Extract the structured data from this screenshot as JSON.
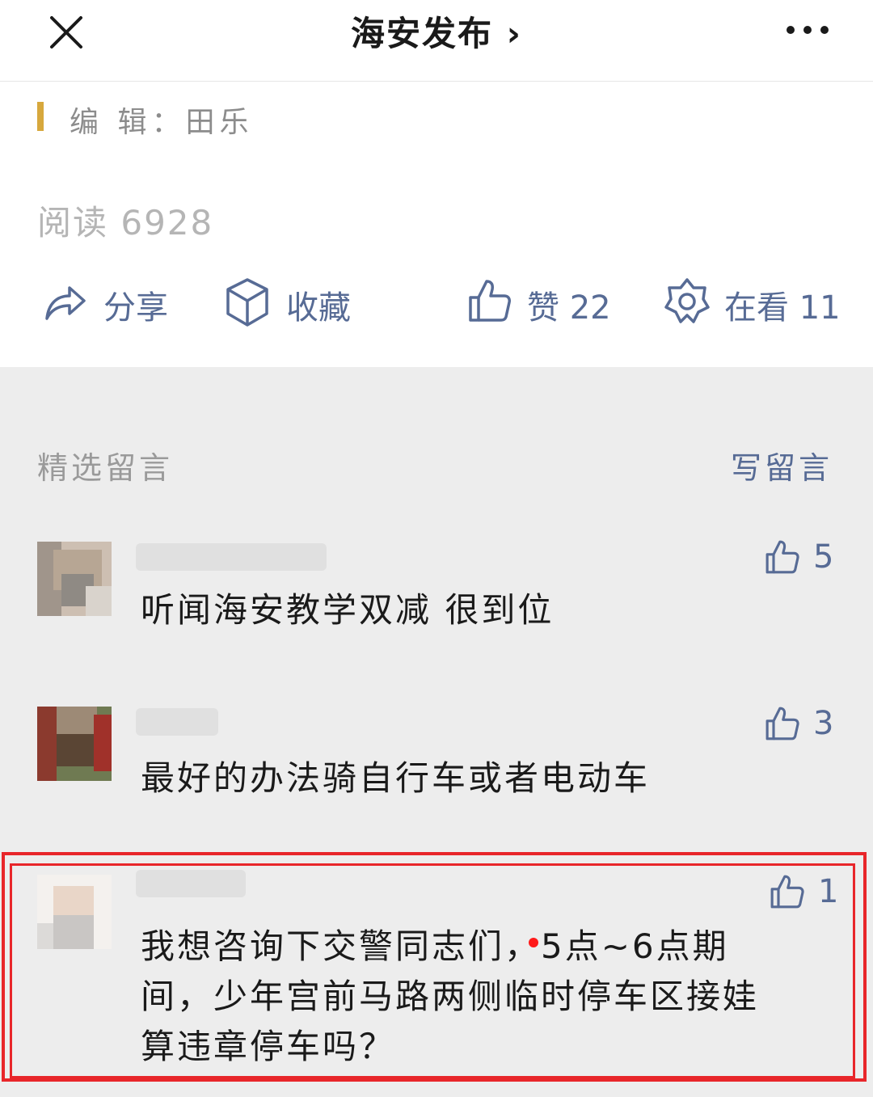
{
  "header": {
    "title": "海安发布 ›"
  },
  "article": {
    "editor": "编 辑：田乐",
    "read": "阅读 6928"
  },
  "actions": {
    "share": "分享",
    "collect": "收藏",
    "like": "赞 22",
    "watch": "在看 11"
  },
  "comments": {
    "section_title": "精选留言",
    "write_label": "写留言",
    "items": [
      {
        "text": "听闻海安教学双减 很到位",
        "likes": "5"
      },
      {
        "text": "最好的办法骑自行车或者电动车",
        "likes": "3"
      },
      {
        "text_lines": [
          "我想咨询下交警同志们，5点~6点期",
          "间，少年宫前马路两侧临时停车区接娃",
          "算违章停车吗？"
        ],
        "likes": "1"
      }
    ]
  },
  "colors": {
    "link": "#576b95",
    "editor_bar": "#d7a83d",
    "highlight_border": "#e8262a",
    "comment_bg": "#ededed"
  },
  "icons": [
    "close-icon",
    "more-icon",
    "share-icon",
    "cube-icon",
    "thumbs-up-icon",
    "flower-icon"
  ]
}
